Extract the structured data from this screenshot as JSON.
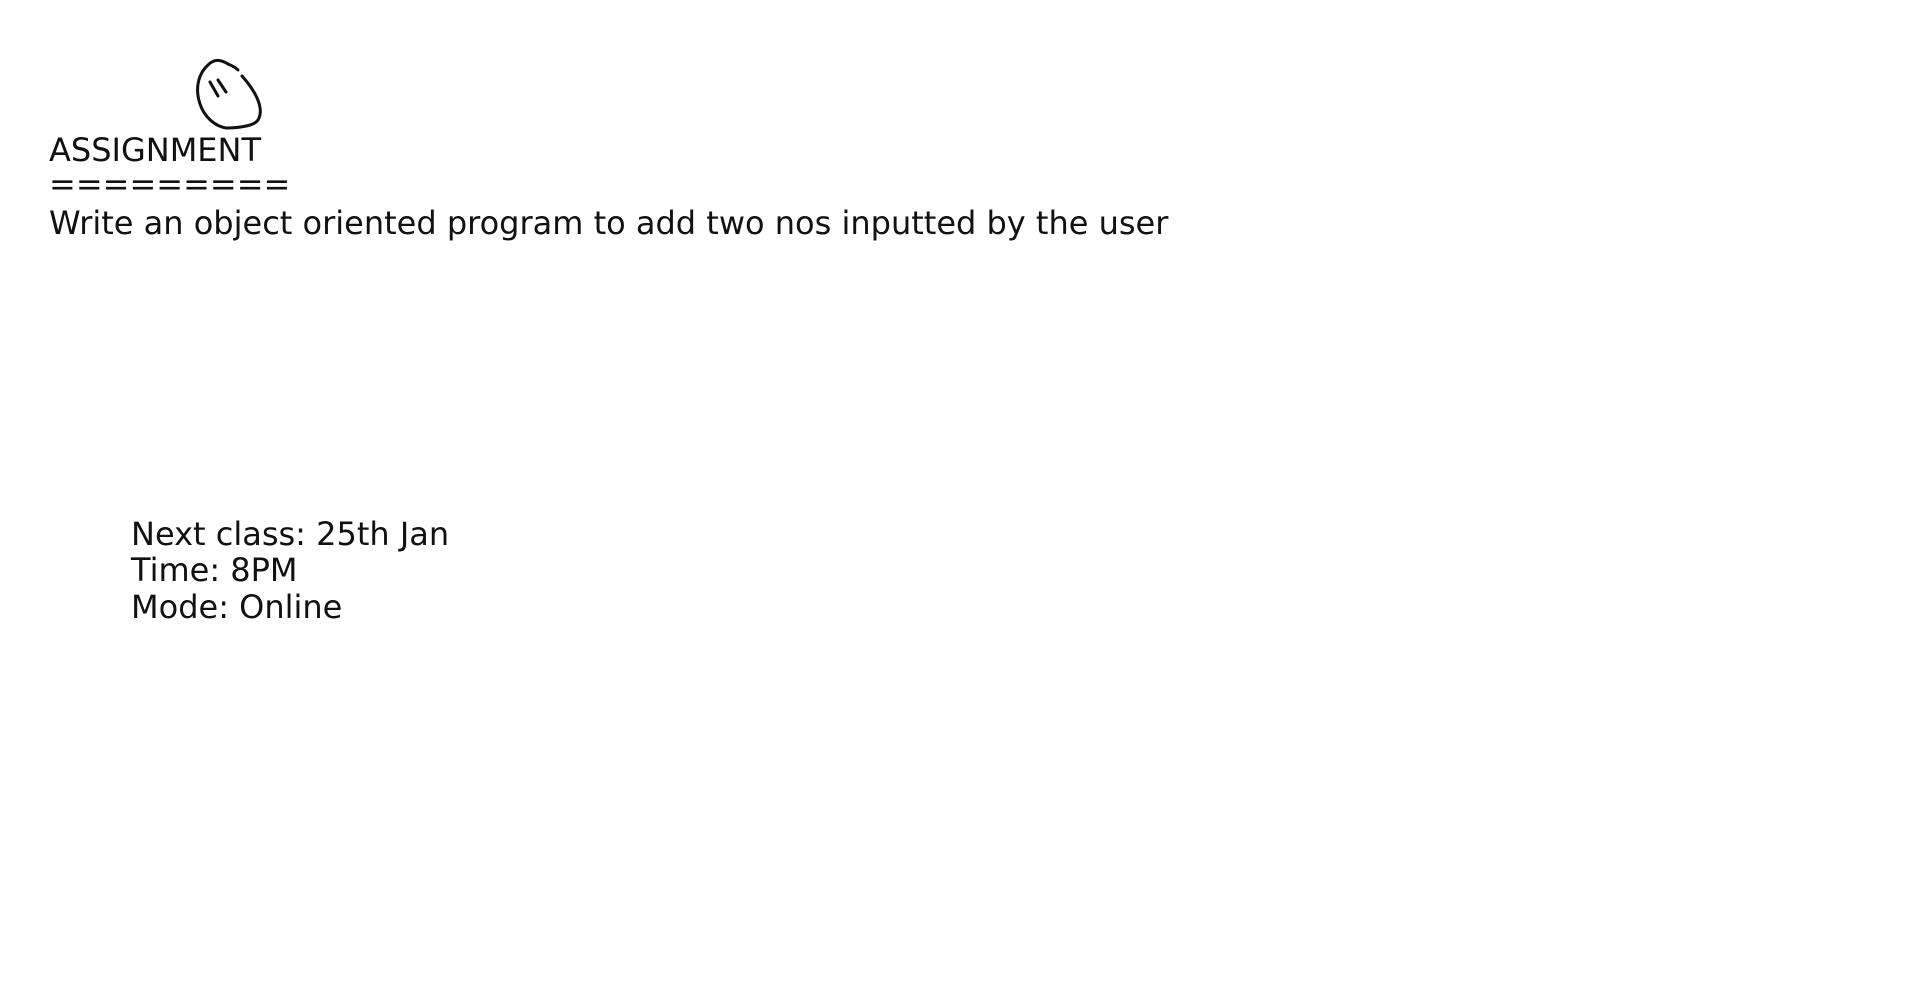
{
  "notes": {
    "heading": "ASSIGNMENT",
    "underline": "=========",
    "task": "Write an object oriented program to add two nos inputted by the user",
    "next_class": "Next class: 25th Jan",
    "time": "Time: 8PM",
    "mode": "Mode: Online"
  },
  "colors": {
    "background": "#ffffff",
    "ink": "#111111"
  }
}
